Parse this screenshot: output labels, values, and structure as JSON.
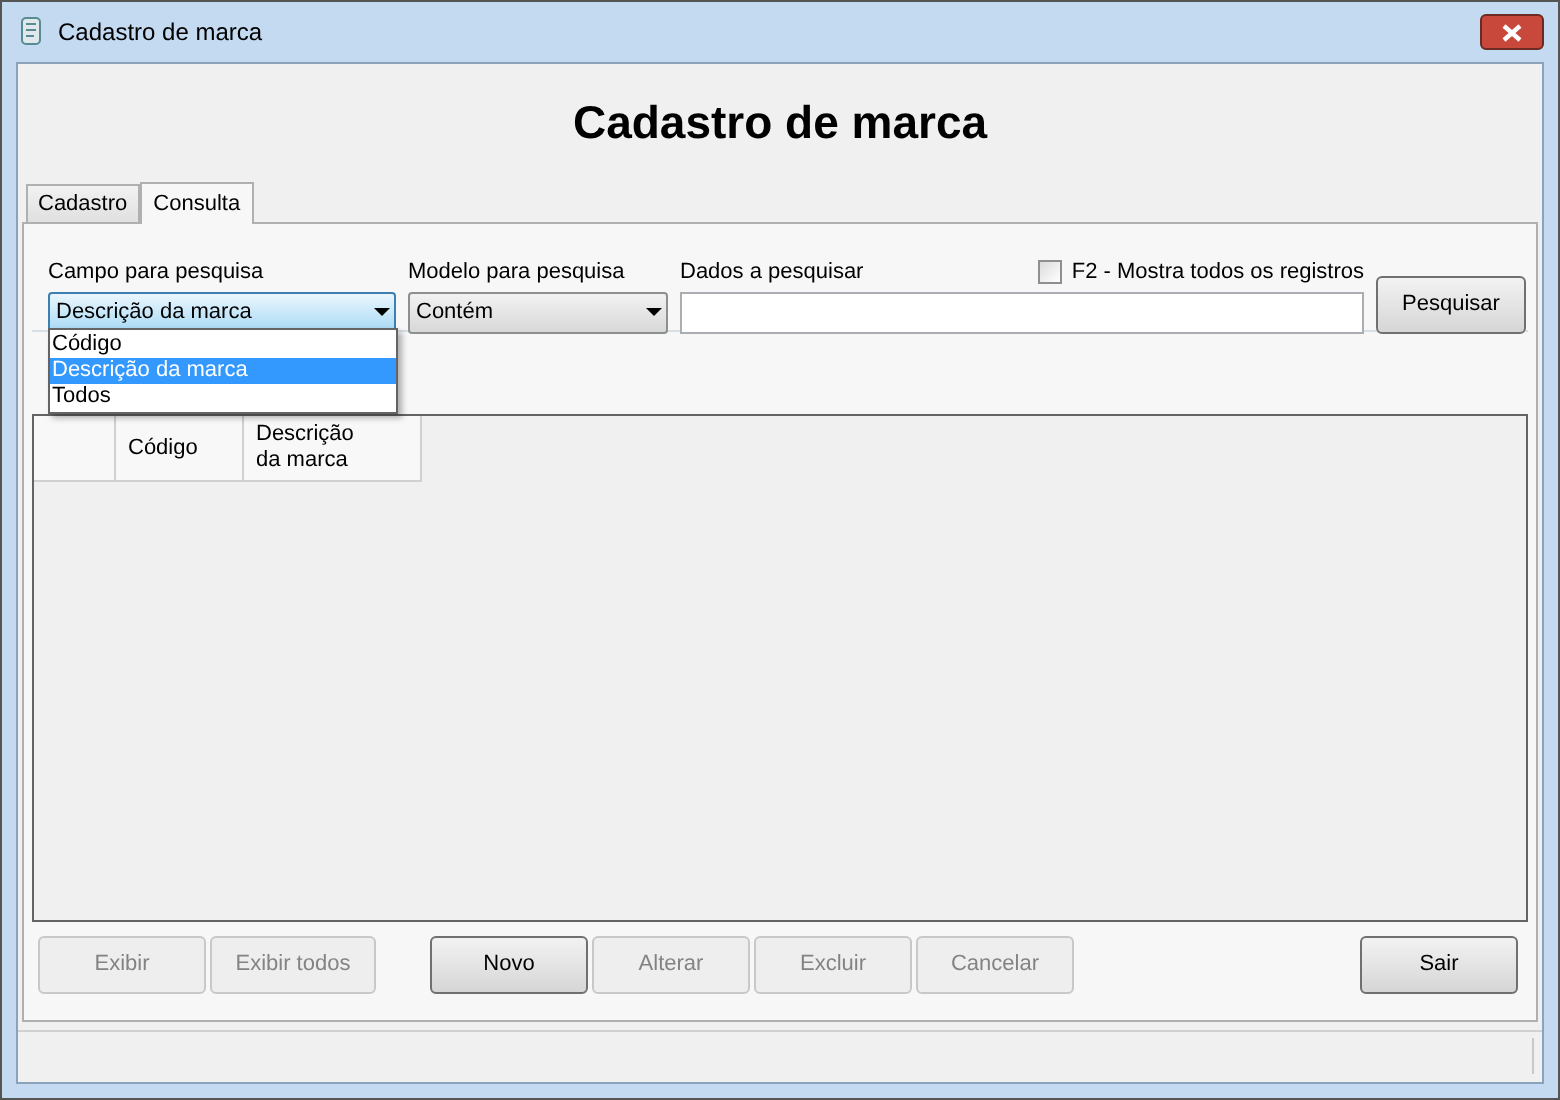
{
  "window": {
    "title": "Cadastro de marca"
  },
  "heading": "Cadastro de marca",
  "tabs": [
    {
      "label": "Cadastro",
      "selected": false
    },
    {
      "label": "Consulta",
      "selected": true
    }
  ],
  "search": {
    "field_label": "Campo para pesquisa",
    "field_value": "Descrição da marca",
    "field_options": [
      {
        "label": "Código",
        "selected": false
      },
      {
        "label": "Descrição da marca",
        "selected": true
      },
      {
        "label": "Todos",
        "selected": false
      }
    ],
    "model_label": "Modelo para pesquisa",
    "model_value": "Contém",
    "data_label": "Dados a pesquisar",
    "show_all": {
      "label": "F2 - Mostra todos os registros",
      "checked": false
    },
    "button": {
      "label": "Pesquisar"
    }
  },
  "table": {
    "columns": [
      "Código",
      "Descrição da marca"
    ]
  },
  "buttons": [
    {
      "label": "Exibir",
      "disabled": true
    },
    {
      "label": "Exibir todos",
      "disabled": true
    },
    {
      "label": "Novo",
      "disabled": false
    },
    {
      "label": "Alterar",
      "disabled": true
    },
    {
      "label": "Excluir",
      "disabled": true
    },
    {
      "label": "Cancelar",
      "disabled": true
    },
    {
      "label": "Sair",
      "disabled": false
    }
  ]
}
